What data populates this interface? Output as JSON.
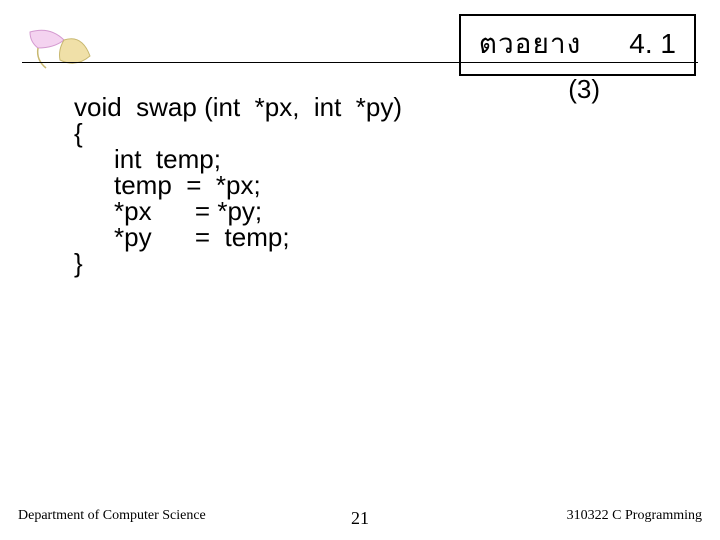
{
  "header": {
    "label": "ตวอยาง",
    "section_number": "4. 1",
    "page_marker": "(3)"
  },
  "code": {
    "signature": "void  swap (int  *px,  int  *py)",
    "open_brace": "{",
    "decl": "int  temp;",
    "assign1": "temp  =  *px;",
    "assign2": "*px      = *py;",
    "assign3": "*py      =  temp;",
    "close_brace": "}"
  },
  "footer": {
    "left": "Department of Computer Science",
    "slide_number": "21",
    "right": "310322 C Programming"
  },
  "icon": {
    "name": "leaf-icon"
  }
}
